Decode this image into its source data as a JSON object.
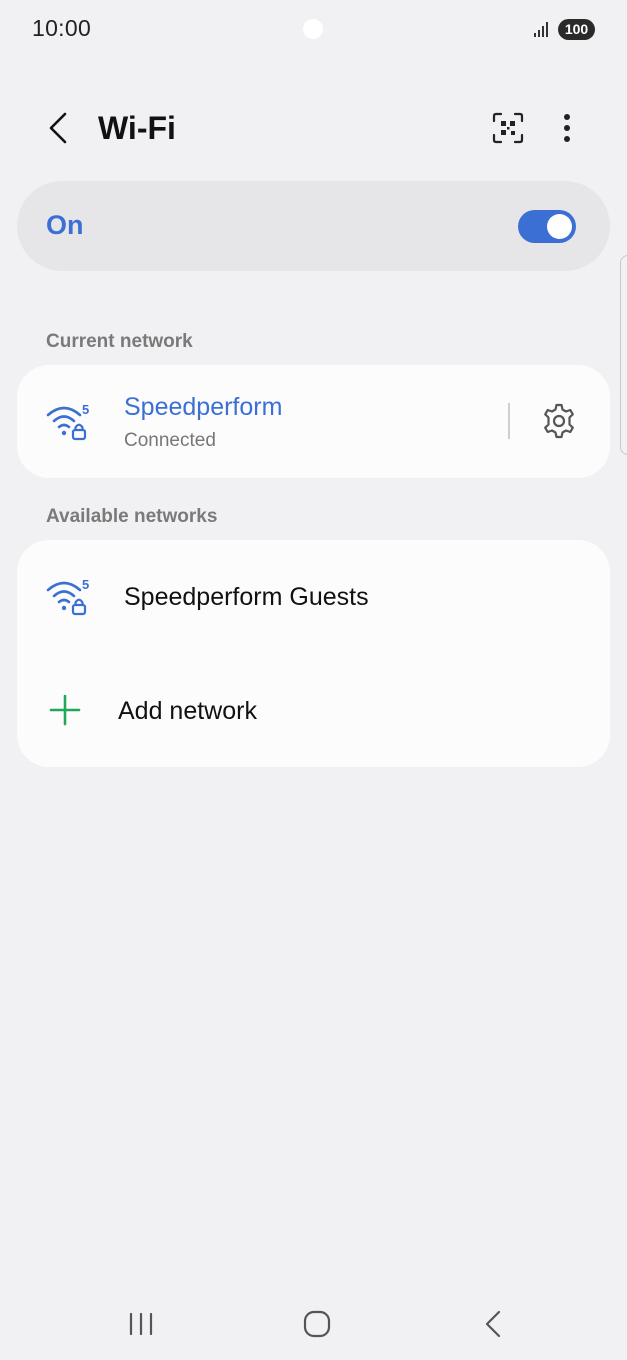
{
  "status_bar": {
    "time": "10:00",
    "battery": "100",
    "icons": [
      "signal-icon",
      "battery-icon"
    ]
  },
  "header": {
    "title": "Wi-Fi",
    "icons": [
      "back-icon",
      "qr-scan-icon",
      "more-vert-icon"
    ]
  },
  "master_switch": {
    "label": "On",
    "state": true,
    "accent": "#3b6fd4"
  },
  "current_section": {
    "title": "Current network",
    "network": {
      "name": "Speedperform",
      "status": "Connected",
      "band": "5",
      "secured": true
    }
  },
  "available_section": {
    "title": "Available networks",
    "networks": [
      {
        "name": "Speedperform Guests",
        "band": "5",
        "secured": true
      }
    ],
    "add_label": "Add network"
  },
  "nav_bar": {
    "icons": [
      "recents-icon",
      "home-icon",
      "back-nav-icon"
    ]
  },
  "colors": {
    "background": "#f1f1f3",
    "card": "#fcfcfd",
    "accent": "#3b6fd4",
    "plus": "#1fa85a"
  }
}
